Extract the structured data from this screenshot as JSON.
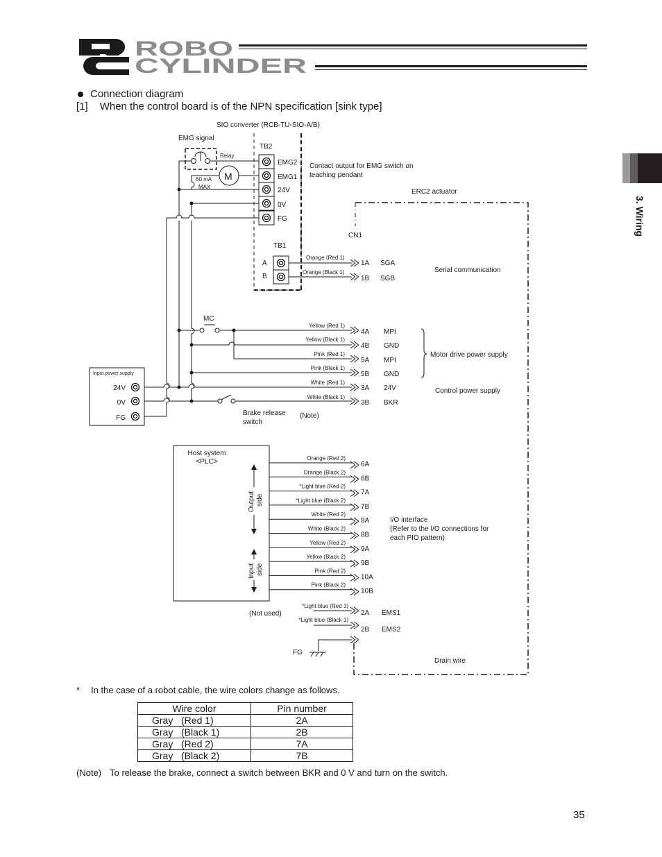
{
  "header": {
    "logo_line1": "ROBO",
    "logo_line2": "CYLINDER",
    "logo_mark": "RC"
  },
  "side_tab": {
    "label": "3. Wiring"
  },
  "section": {
    "bullet_title": "Connection diagram",
    "subtitle_num": "[1]",
    "subtitle": "When the control board is of the NPN specification [sink type]"
  },
  "diagram": {
    "sio_converter": "SIO converter (RCB-TU-SIO-A/B)",
    "emg_signal": "EMG signal",
    "relay": "Relay",
    "motor_symbol": "M",
    "relay_current_1": "60 mA",
    "relay_current_2": "MAX",
    "tb2": {
      "label": "TB2",
      "terminals": [
        "EMG2",
        "EMG1",
        "24V",
        "0V",
        "FG"
      ]
    },
    "contact_output_1": "Contact output for EMG switch on",
    "contact_output_2": "teaching pendant",
    "erc2_actuator": "ERC2 actuator",
    "cn1": "CN1",
    "tb1": {
      "label": "TB1",
      "terminals": [
        "A",
        "B"
      ]
    },
    "serial_wires": [
      {
        "color": "Orange (Red 1)",
        "pin": "1A",
        "signal": "SGA"
      },
      {
        "color": "Orange (Black 1)",
        "pin": "1B",
        "signal": "SGB"
      }
    ],
    "serial_group": "Serial communication",
    "mc": "MC",
    "power_wires": [
      {
        "color": "Yellow (Red 1)",
        "pin": "4A",
        "signal": "MPI"
      },
      {
        "color": "Yellow (Black 1)",
        "pin": "4B",
        "signal": "GND"
      },
      {
        "color": "Pink (Red 1)",
        "pin": "5A",
        "signal": "MPI"
      },
      {
        "color": "Pink (Black 1)",
        "pin": "5B",
        "signal": "GND"
      },
      {
        "color": "White (Red 1)",
        "pin": "3A",
        "signal": "24V"
      },
      {
        "color": "White (Black 1)",
        "pin": "3B",
        "signal": "BKR"
      }
    ],
    "motor_group": "Motor drive power supply",
    "control_group": "Control power supply",
    "input_power": {
      "label": "Input power supply",
      "terminals": [
        "24V",
        "0V",
        "FG"
      ]
    },
    "brake_switch_1": "Brake release",
    "brake_switch_2": "switch",
    "note_ref": "(Note)",
    "host": {
      "line1": "Host system",
      "line2": "<PLC>",
      "output_side_1": "Output",
      "output_side_2": "side",
      "input_side_1": "Input",
      "input_side_2": "side"
    },
    "io_wires": [
      {
        "color": "Orange (Red 2)",
        "pin": "6A"
      },
      {
        "color": "Orange (Black 2)",
        "pin": "6B"
      },
      {
        "color": "*Light blue (Red 2)",
        "pin": "7A"
      },
      {
        "color": "*Light blue (Black 2)",
        "pin": "7B"
      },
      {
        "color": "White (Red 2)",
        "pin": "8A"
      },
      {
        "color": "White (Black 2)",
        "pin": "8B"
      },
      {
        "color": "Yellow (Red 2)",
        "pin": "9A"
      },
      {
        "color": "Yellow (Black 2)",
        "pin": "9B"
      },
      {
        "color": "Pink (Red 2)",
        "pin": "10A"
      },
      {
        "color": "Pink (Black 2)",
        "pin": "10B"
      }
    ],
    "io_group_1": "I/O interface",
    "io_group_2": "(Refer to the I/O connections for",
    "io_group_3": "each PIO pattern)",
    "not_used": "(Not used)",
    "ems_wires": [
      {
        "color": "*Light blue (Red 1)",
        "pin": "2A",
        "signal": "EMS1"
      },
      {
        "color": "*Light blue (Black 1)",
        "pin": "2B",
        "signal": "EMS2"
      }
    ],
    "fg": "FG",
    "drain_wire": "Drain wire"
  },
  "footnote": {
    "marker": "*",
    "text": "In the case of a robot cable, the wire colors change as follows."
  },
  "wire_table": {
    "headers": [
      "Wire color",
      "Pin number"
    ],
    "rows": [
      {
        "color": "Gray   (Red 1)",
        "pin": "2A"
      },
      {
        "color": "Gray   (Black 1)",
        "pin": "2B"
      },
      {
        "color": "Gray   (Red 2)",
        "pin": "7A"
      },
      {
        "color": "Gray   (Black 2)",
        "pin": "7B"
      }
    ]
  },
  "note": {
    "label": "(Note)",
    "text": "To release the brake, connect a switch between BKR and 0 V and turn on the switch."
  },
  "page_number": "35"
}
